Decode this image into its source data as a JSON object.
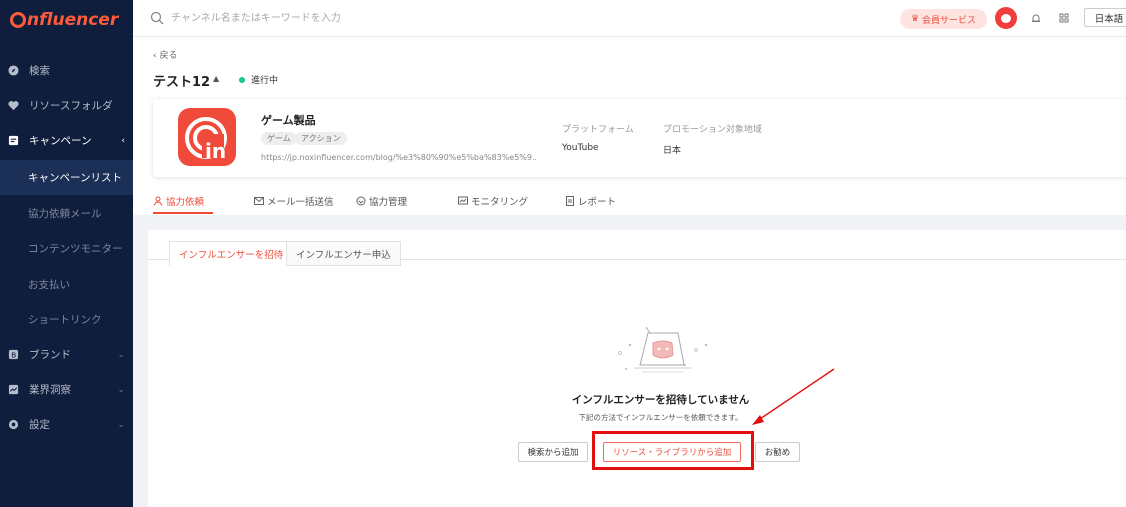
{
  "brand": {
    "logo_text": "nfluencer",
    "accent": "#ff5a3c"
  },
  "sidebar": {
    "items": [
      {
        "label": "検索",
        "icon": "compass-icon"
      },
      {
        "label": "リソースフォルダ",
        "icon": "heart-icon"
      },
      {
        "label": "キャンペーン",
        "icon": "campaign-icon",
        "expanded": true
      },
      {
        "label": "ブランド",
        "icon": "brand-icon"
      },
      {
        "label": "業界洞察",
        "icon": "insight-icon"
      },
      {
        "label": "設定",
        "icon": "gear-icon"
      }
    ],
    "sub_items": [
      {
        "label": "キャンペーンリスト",
        "active": true
      },
      {
        "label": "協力依頼メール"
      },
      {
        "label": "コンテンツモニター"
      },
      {
        "label": "お支払い"
      },
      {
        "label": "ショートリンク"
      }
    ]
  },
  "topbar": {
    "search_placeholder": "チャンネル名またはキーワードを入力",
    "member_label": "会員サービス",
    "language": "日本語"
  },
  "campaign": {
    "back_label": "戻る",
    "title": "テスト12",
    "status": "進行中",
    "status_color": "#1ec28b"
  },
  "product": {
    "name": "ゲーム製品",
    "tags": [
      "ゲーム",
      "アクション"
    ],
    "url": "https://jp.noxinfluencer.com/blog/%e3%80%90%e5%ba%83%e5%9...",
    "platform_label": "プラットフォーム",
    "platform_value": "YouTube",
    "region_label": "プロモーション対象地域",
    "region_value": "日本"
  },
  "tabs": [
    {
      "label": "協力依頼",
      "icon": "person-icon",
      "active": true
    },
    {
      "label": "メール一括送信",
      "icon": "mail-icon"
    },
    {
      "label": "協力管理",
      "icon": "handshake-icon"
    },
    {
      "label": "モニタリング",
      "icon": "monitor-icon"
    },
    {
      "label": "レポート",
      "icon": "report-icon"
    }
  ],
  "subtabs": [
    {
      "label": "インフルエンサーを招待",
      "active": true
    },
    {
      "label": "インフルエンサー申込"
    }
  ],
  "empty_state": {
    "title": "インフルエンサーを招待していません",
    "subtitle": "下記の方法でインフルエンサーを依頼できます。",
    "buttons": [
      "検索から追加",
      "リソース・ライブラリから追加",
      "お勧め"
    ]
  },
  "colors": {
    "sidebar_bg": "#0f1e3d",
    "accent_red": "#ef4b3a",
    "annotation_red": "#e20f0f"
  }
}
